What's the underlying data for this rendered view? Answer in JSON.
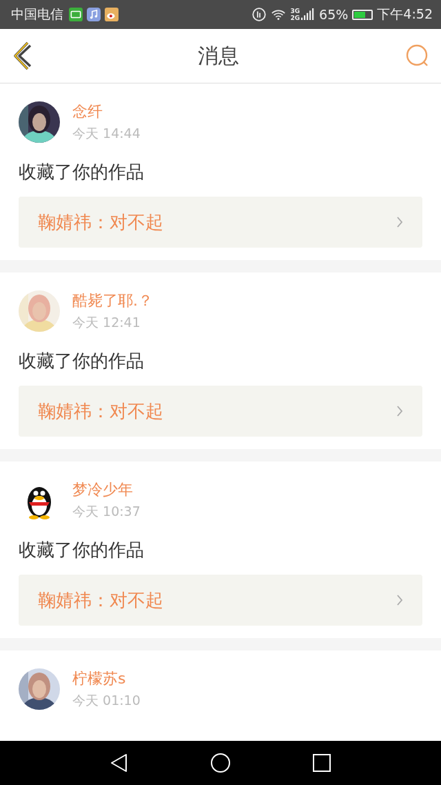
{
  "status_bar": {
    "carrier": "中国电信",
    "network": "3G",
    "network2": "2G",
    "battery_percent": "65%",
    "time": "下午4:52"
  },
  "header": {
    "title": "消息"
  },
  "messages": [
    {
      "user": "念纤",
      "time": "今天 14:44",
      "action": "收藏了你的作品",
      "work": "鞠婧祎：对不起"
    },
    {
      "user": "酷毙了耶.？",
      "time": "今天 12:41",
      "action": "收藏了你的作品",
      "work": "鞠婧祎：对不起"
    },
    {
      "user": "梦冷少年",
      "time": "今天 10:37",
      "avatar": {
        "kind": "penguin"
      },
      "action": "收藏了你的作品",
      "work": "鞠婧祎：对不起"
    },
    {
      "user": "柠檬苏s",
      "time": "今天 01:10"
    }
  ]
}
